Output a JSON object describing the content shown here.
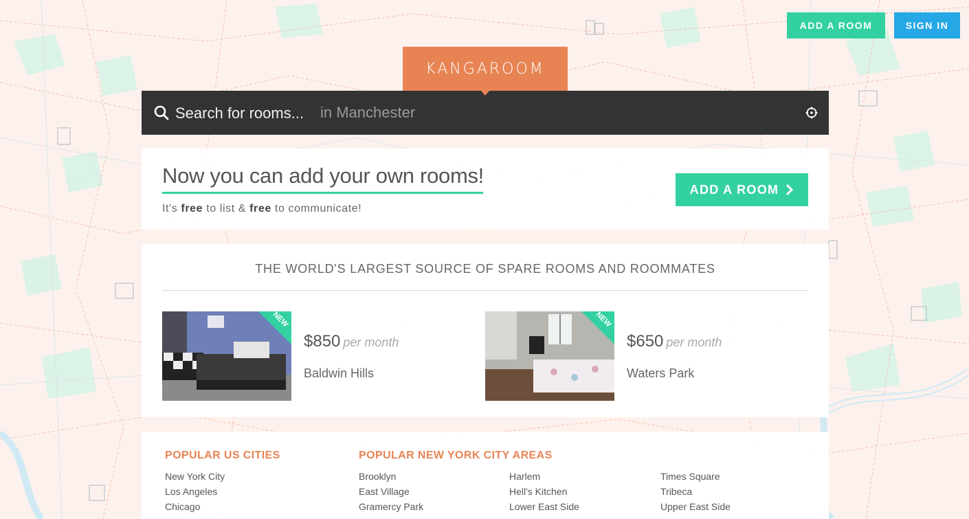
{
  "header": {
    "add_room_label": "ADD A ROOM",
    "sign_in_label": "SIGN IN"
  },
  "logo": {
    "text": "KANGAROOM"
  },
  "search": {
    "placeholder": "Search for rooms...",
    "location": "in Manchester"
  },
  "promo": {
    "title": "Now you can add your own rooms!",
    "sub_parts": [
      "It's ",
      "free",
      " to list & ",
      "free",
      " to communicate!"
    ],
    "button_label": "ADD A ROOM"
  },
  "listings": {
    "heading": "THE WORLD'S LARGEST SOURCE OF SPARE ROOMS AND ROOMMATES",
    "items": [
      {
        "price": "$850",
        "per": "per month",
        "area": "Baldwin Hills",
        "badge": "NEW"
      },
      {
        "price": "$650",
        "per": "per month",
        "area": "Waters Park",
        "badge": "NEW"
      }
    ]
  },
  "popular": {
    "us_heading": "POPULAR US CITIES",
    "nyc_heading": "POPULAR NEW YORK CITY AREAS",
    "us_cities": [
      "New York City",
      "Los Angeles",
      "Chicago"
    ],
    "nyc_col1": [
      "Brooklyn",
      "East Village",
      "Gramercy Park"
    ],
    "nyc_col2": [
      "Harlem",
      "Hell's Kitchen",
      "Lower East Side"
    ],
    "nyc_col3": [
      "Times Square",
      "Tribeca",
      "Upper East Side"
    ]
  },
  "colors": {
    "accent_green": "#33d1a1",
    "accent_blue": "#26a7e6",
    "brand_orange": "#e88454",
    "search_bg": "#333333"
  }
}
